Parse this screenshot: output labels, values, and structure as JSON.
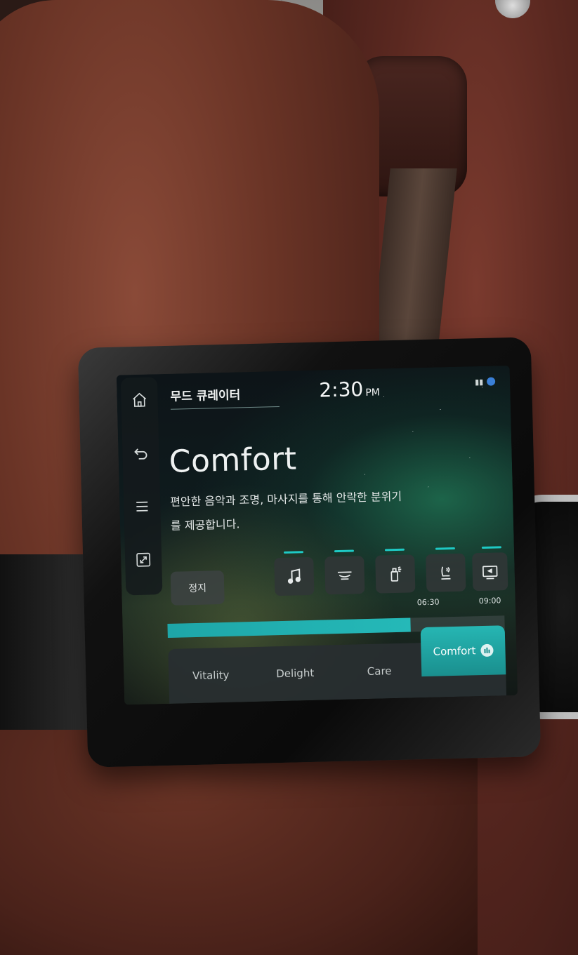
{
  "app": {
    "title": "무드 큐레이터",
    "clock_time": "2:30",
    "clock_ampm": "PM"
  },
  "sidebar": {
    "items": [
      {
        "name": "home",
        "icon": "home-icon"
      },
      {
        "name": "back",
        "icon": "back-icon"
      },
      {
        "name": "menu",
        "icon": "menu-icon"
      },
      {
        "name": "fullscreen",
        "icon": "fullscreen-icon"
      }
    ]
  },
  "hero": {
    "title": "Comfort",
    "description": "편안한 음악과 조명, 마사지를 통해 안락한 분위기를 제공합니다."
  },
  "controls": {
    "stop_label": "정지"
  },
  "features": [
    {
      "name": "music",
      "icon": "music-note-icon"
    },
    {
      "name": "lighting",
      "icon": "mood-light-icon"
    },
    {
      "name": "fragrance",
      "icon": "fragrance-icon"
    },
    {
      "name": "massage",
      "icon": "massage-seat-icon"
    },
    {
      "name": "display",
      "icon": "display-icon"
    }
  ],
  "timeline": {
    "current_label": "06:30",
    "end_label": "09:00",
    "progress_fraction": 0.72
  },
  "tabs": [
    {
      "label": "Vitality",
      "active": false
    },
    {
      "label": "Delight",
      "active": false
    },
    {
      "label": "Care",
      "active": false
    },
    {
      "label": "Comfort",
      "active": true
    }
  ],
  "colors": {
    "accent": "#1ec9c4",
    "screen_bg": "#0f1c1e",
    "seat_leather": "#6a3426"
  }
}
